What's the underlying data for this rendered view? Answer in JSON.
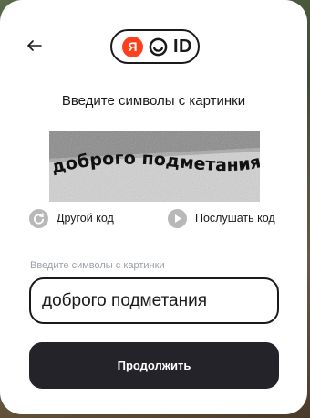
{
  "logo": {
    "letter": "Я",
    "suffix": "ID",
    "brand_color": "#fc3f1d"
  },
  "back_icon": "arrow-left-icon",
  "title": "Введите символы с картинки",
  "captcha": {
    "text": "доброго подметания"
  },
  "actions": {
    "refresh_label": "Другой код",
    "refresh_icon": "refresh-icon",
    "listen_label": "Послушать код",
    "listen_icon": "play-icon"
  },
  "form": {
    "field_label": "Введите символы с картинки",
    "input_value": "доброго подметания",
    "submit_label": "Продолжить"
  },
  "colors": {
    "primary_button": "#24232a",
    "text": "#1a1a1a",
    "label": "#9aa1a8"
  }
}
